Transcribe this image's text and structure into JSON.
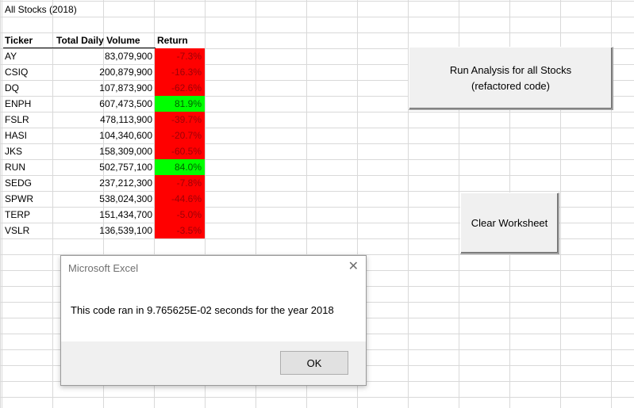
{
  "sheet": {
    "title": "All Stocks (2018)",
    "headers": {
      "ticker": "Ticker",
      "volume": "Total Daily Volume",
      "return": "Return"
    },
    "rows": [
      {
        "ticker": "AY",
        "volume": "83,079,900",
        "return": "-7.3%",
        "status": "neg"
      },
      {
        "ticker": "CSIQ",
        "volume": "200,879,900",
        "return": "-16.3%",
        "status": "neg"
      },
      {
        "ticker": "DQ",
        "volume": "107,873,900",
        "return": "-62.6%",
        "status": "neg"
      },
      {
        "ticker": "ENPH",
        "volume": "607,473,500",
        "return": "81.9%",
        "status": "pos"
      },
      {
        "ticker": "FSLR",
        "volume": "478,113,900",
        "return": "-39.7%",
        "status": "neg"
      },
      {
        "ticker": "HASI",
        "volume": "104,340,600",
        "return": "-20.7%",
        "status": "neg"
      },
      {
        "ticker": "JKS",
        "volume": "158,309,000",
        "return": "-60.5%",
        "status": "neg"
      },
      {
        "ticker": "RUN",
        "volume": "502,757,100",
        "return": "84.0%",
        "status": "pos"
      },
      {
        "ticker": "SEDG",
        "volume": "237,212,300",
        "return": "-7.8%",
        "status": "neg"
      },
      {
        "ticker": "SPWR",
        "volume": "538,024,300",
        "return": "-44.6%",
        "status": "neg"
      },
      {
        "ticker": "TERP",
        "volume": "151,434,700",
        "return": "-5.0%",
        "status": "neg"
      },
      {
        "ticker": "VSLR",
        "volume": "136,539,100",
        "return": "-3.5%",
        "status": "neg"
      }
    ],
    "colors": {
      "negative_fill": "#ff0000",
      "positive_fill": "#00ff00"
    }
  },
  "buttons": {
    "run_analysis": "Run Analysis for all Stocks\n(refactored code)",
    "clear_worksheet": "Clear Worksheet"
  },
  "dialog": {
    "title": "Microsoft Excel",
    "close_icon": "close-icon",
    "message": "This code ran in 9.765625E-02 seconds for the year 2018",
    "ok_label": "OK"
  }
}
